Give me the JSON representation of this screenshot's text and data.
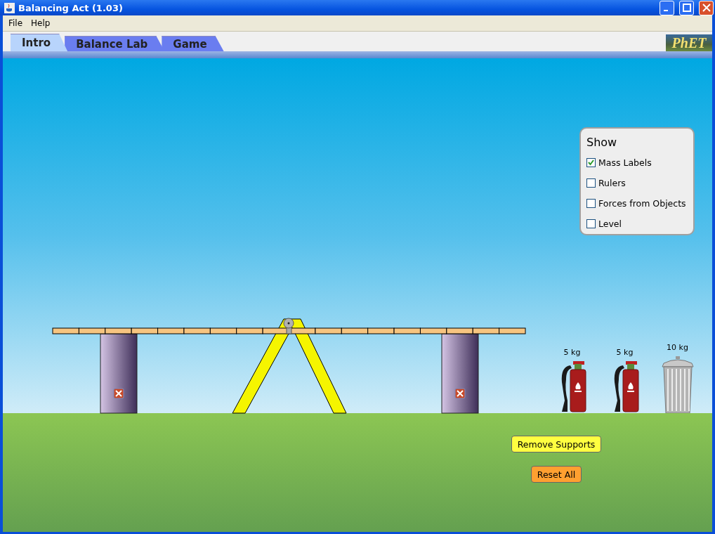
{
  "window": {
    "title": "Balancing Act (1.03)"
  },
  "menu": [
    "File",
    "Help"
  ],
  "tabs": [
    {
      "label": "Intro",
      "selected": true
    },
    {
      "label": "Balance Lab",
      "selected": false
    },
    {
      "label": "Game",
      "selected": false
    }
  ],
  "logo": "PhET",
  "show_panel": {
    "title": "Show",
    "options": [
      {
        "label": "Mass Labels",
        "checked": true
      },
      {
        "label": "Rulers",
        "checked": false
      },
      {
        "label": "Forces from Objects",
        "checked": false
      },
      {
        "label": "Level",
        "checked": false
      }
    ]
  },
  "masses": [
    {
      "kind": "extinguisher",
      "label": "5 kg"
    },
    {
      "kind": "extinguisher",
      "label": "5 kg"
    },
    {
      "kind": "trash-can",
      "label": "10 kg"
    }
  ],
  "buttons": [
    {
      "kind": "remove",
      "label": "Remove Supports"
    },
    {
      "kind": "reset",
      "label": "Reset All"
    }
  ]
}
